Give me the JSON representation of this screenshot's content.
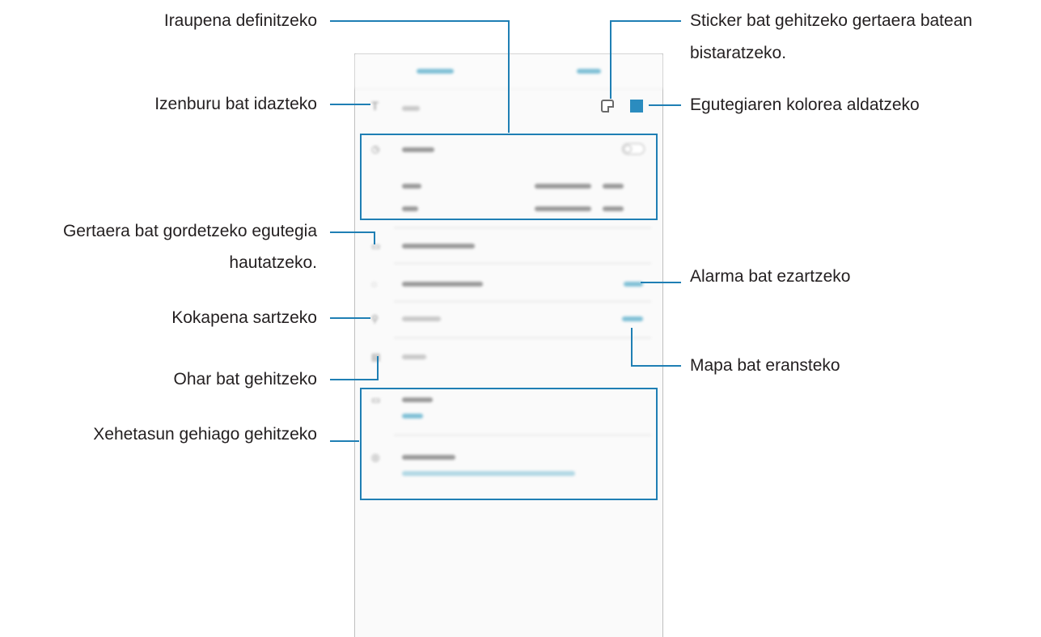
{
  "callouts": {
    "duration": "Iraupena definitzeko",
    "title": "Izenburu bat idazteko",
    "calendar_line1": "Gertaera bat gordetzeko egutegia",
    "calendar_line2": "hautatzeko.",
    "location": "Kokapena sartzeko",
    "note": "Ohar bat gehitzeko",
    "details": "Xehetasun gehiago gehitzeko",
    "sticker_line1": "Sticker bat gehitzeko gertaera batean",
    "sticker_line2": "bistaratzeko.",
    "color": "Egutegiaren kolorea aldatzeko",
    "alarm": "Alarma bat ezartzeko",
    "map": "Mapa bat eransteko"
  },
  "icons": [
    "title-icon",
    "clock-icon",
    "calendar-icon",
    "alarm-icon",
    "location-pin-icon",
    "note-icon",
    "repeat-icon",
    "globe-icon",
    "sticker-icon"
  ],
  "colors": {
    "accent": "#1f7fb4",
    "calendar_color": "#2b8cbf"
  }
}
